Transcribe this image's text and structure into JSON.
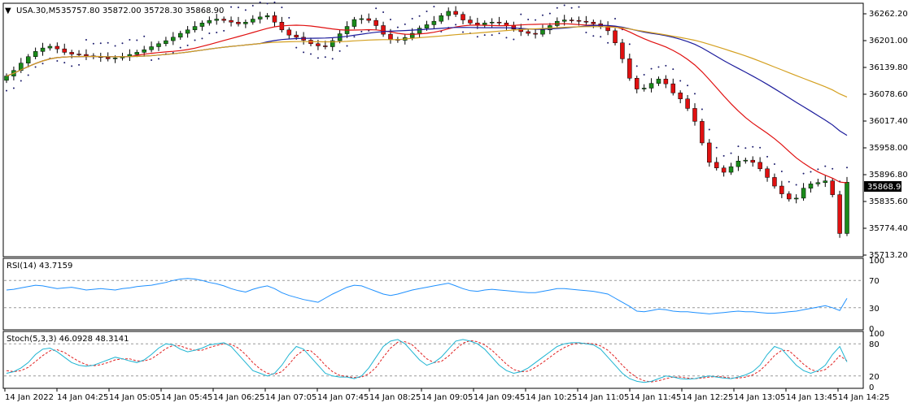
{
  "main_pane": {
    "symbol_label": "USA.30,M5",
    "ohlc_label": "35757.80 35872.00 35728.30 35868.90",
    "price_ticks": [
      "36262.20",
      "36201.00",
      "36139.80",
      "36078.60",
      "36017.40",
      "35958.00",
      "35896.80",
      "35835.60",
      "35774.40",
      "35713.20"
    ],
    "current_price": "35868.90",
    "up_color": "#1a8a1a",
    "down_color": "#e01010"
  },
  "rsi_pane": {
    "label": "RSI(14) 43.7159",
    "ticks": [
      "100",
      "70",
      "30",
      "0"
    ],
    "line_color": "#1e90ff"
  },
  "stoch_pane": {
    "label": "Stoch(5,3,3) 46.0928 48.3141",
    "ticks": [
      "100",
      "80",
      "20",
      "0"
    ],
    "main_color": "#1eb4d2",
    "signal_color": "#e02020"
  },
  "time_axis": {
    "labels": [
      "14 Jan 2022",
      "14 Jan 04:25",
      "14 Jan 05:05",
      "14 Jan 05:45",
      "14 Jan 06:25",
      "14 Jan 07:05",
      "14 Jan 07:45",
      "14 Jan 08:25",
      "14 Jan 09:05",
      "14 Jan 09:45",
      "14 Jan 10:25",
      "14 Jan 11:05",
      "14 Jan 11:45",
      "14 Jan 12:25",
      "14 Jan 13:05",
      "14 Jan 13:45",
      "14 Jan 14:25"
    ]
  },
  "chart_data": {
    "type": "candlestick",
    "price_range": [
      35700,
      36280
    ],
    "candles_close": [
      36115,
      36128,
      36145,
      36160,
      36172,
      36180,
      36184,
      36178,
      36170,
      36166,
      36165,
      36162,
      36160,
      36158,
      36155,
      36157,
      36160,
      36165,
      36170,
      36176,
      36183,
      36190,
      36197,
      36205,
      36214,
      36222,
      36230,
      36238,
      36244,
      36247,
      36244,
      36240,
      36236,
      36240,
      36247,
      36252,
      36255,
      36240,
      36222,
      36210,
      36205,
      36198,
      36190,
      36185,
      36183,
      36197,
      36213,
      36230,
      36246,
      36248,
      36244,
      36232,
      36212,
      36200,
      36198,
      36204,
      36214,
      36226,
      36234,
      36242,
      36255,
      36265,
      36258,
      36245,
      36238,
      36234,
      36238,
      36240,
      36238,
      36232,
      36224,
      36218,
      36214,
      36212,
      36222,
      36232,
      36242,
      36245,
      36244,
      36242,
      36240,
      36236,
      36230,
      36220,
      36192,
      36155,
      36110,
      36085,
      36087,
      36098,
      36108,
      36097,
      36076,
      36062,
      36040,
      36010,
      35960,
      35915,
      35902,
      35892,
      35905,
      35918,
      35920,
      35915,
      35900,
      35880,
      35860,
      35842,
      35830,
      35832,
      35855,
      35865,
      35868,
      35872,
      35840,
      35750,
      35868.9
    ],
    "rsi": [
      56,
      57,
      59,
      61,
      63,
      62,
      60,
      58,
      59,
      60,
      58,
      56,
      57,
      58,
      57,
      56,
      58,
      59,
      61,
      62,
      63,
      65,
      67,
      70,
      72,
      73,
      72,
      70,
      67,
      65,
      62,
      58,
      55,
      53,
      57,
      60,
      62,
      58,
      52,
      48,
      45,
      42,
      40,
      38,
      44,
      50,
      55,
      60,
      63,
      62,
      58,
      54,
      50,
      48,
      50,
      53,
      56,
      58,
      60,
      62,
      64,
      66,
      62,
      58,
      55,
      54,
      56,
      57,
      56,
      55,
      54,
      53,
      52,
      52,
      54,
      56,
      58,
      58,
      57,
      56,
      55,
      54,
      52,
      50,
      44,
      38,
      32,
      25,
      24,
      26,
      28,
      27,
      25,
      24,
      24,
      23,
      22,
      21,
      22,
      23,
      24,
      25,
      24,
      24,
      23,
      22,
      22,
      23,
      24,
      25,
      27,
      29,
      31,
      33,
      30,
      26,
      43.7
    ],
    "stoch_main": [
      25,
      28,
      35,
      45,
      60,
      70,
      72,
      65,
      55,
      45,
      40,
      38,
      40,
      45,
      50,
      55,
      52,
      48,
      45,
      50,
      60,
      72,
      80,
      78,
      70,
      65,
      68,
      72,
      78,
      80,
      82,
      75,
      60,
      45,
      30,
      25,
      20,
      25,
      40,
      60,
      75,
      70,
      55,
      40,
      25,
      20,
      18,
      18,
      15,
      20,
      35,
      55,
      75,
      85,
      88,
      80,
      65,
      50,
      40,
      45,
      55,
      70,
      85,
      88,
      85,
      80,
      70,
      55,
      40,
      30,
      25,
      28,
      35,
      45,
      55,
      65,
      75,
      80,
      82,
      82,
      80,
      78,
      70,
      55,
      40,
      25,
      15,
      10,
      8,
      10,
      15,
      20,
      18,
      15,
      14,
      15,
      18,
      20,
      18,
      16,
      15,
      18,
      22,
      28,
      40,
      60,
      75,
      70,
      55,
      40,
      30,
      25,
      30,
      40,
      60,
      75,
      46.1
    ],
    "stoch_signal": [
      30,
      28,
      30,
      36,
      47,
      58,
      67,
      69,
      64,
      55,
      47,
      41,
      39,
      41,
      45,
      50,
      52,
      52,
      48,
      48,
      52,
      61,
      71,
      77,
      76,
      71,
      68,
      68,
      73,
      77,
      80,
      79,
      72,
      60,
      45,
      33,
      25,
      23,
      28,
      42,
      58,
      68,
      67,
      55,
      40,
      28,
      21,
      19,
      17,
      18,
      24,
      36,
      55,
      72,
      83,
      84,
      78,
      65,
      52,
      45,
      47,
      57,
      70,
      81,
      86,
      84,
      78,
      68,
      55,
      42,
      32,
      28,
      29,
      36,
      45,
      55,
      65,
      73,
      79,
      81,
      81,
      80,
      76,
      68,
      55,
      40,
      27,
      17,
      11,
      9,
      11,
      15,
      18,
      18,
      16,
      15,
      16,
      18,
      19,
      18,
      16,
      16,
      18,
      22,
      30,
      43,
      58,
      68,
      67,
      55,
      42,
      32,
      28,
      32,
      43,
      58,
      48.3
    ]
  }
}
